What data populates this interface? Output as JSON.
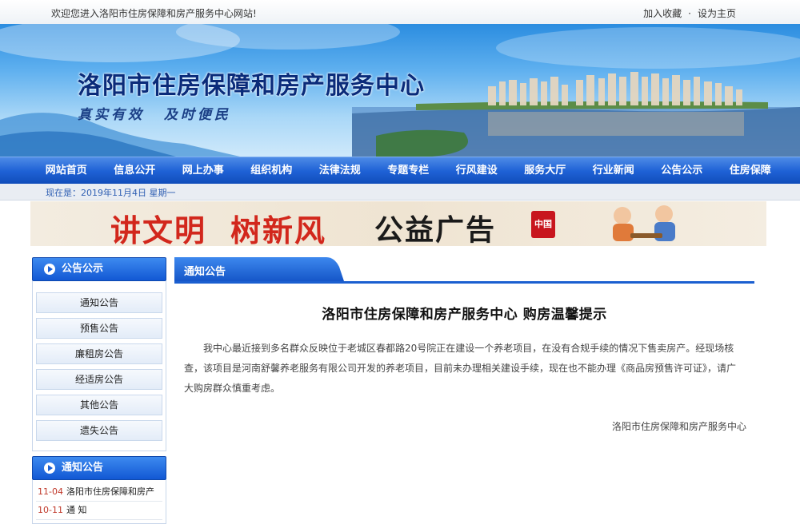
{
  "topbar": {
    "welcome": "欢迎您进入洛阳市住房保障和房产服务中心网站!",
    "favorite": "加入收藏",
    "separator": "·",
    "homepage": "设为主页"
  },
  "banner": {
    "title": "洛阳市住房保障和房产服务中心",
    "slogan": "真实有效 及时便民"
  },
  "nav": {
    "items": [
      "网站首页",
      "信息公开",
      "网上办事",
      "组织机构",
      "法律法规",
      "专题专栏",
      "行风建设",
      "服务大厅",
      "行业新闻",
      "公告公示",
      "住房保障"
    ]
  },
  "date_row": {
    "text": "现在是：2019年11月4日 星期一"
  },
  "ad": {
    "part1": "讲文明",
    "part2": "树新风",
    "part3": "公益广告",
    "seal": "中国梦"
  },
  "sidebar": {
    "section1": {
      "title": "公告公示",
      "items": [
        "通知公告",
        "预售公告",
        "廉租房公告",
        "经适房公告",
        "其他公告",
        "遗失公告"
      ]
    },
    "section2": {
      "title": "通知公告",
      "rows": [
        {
          "date": "11-04",
          "text": "洛阳市住房保障和房产"
        },
        {
          "date": "10-11",
          "text": "通 知"
        }
      ]
    }
  },
  "main": {
    "tab": "通知公告",
    "article_title": "洛阳市住房保障和房产服务中心  购房温馨提示",
    "body": "我中心最近接到多名群众反映位于老城区春都路20号院正在建设一个养老项目，在没有合规手续的情况下售卖房产。经现场核查，该项目是河南舒馨养老服务有限公司开发的养老项目，目前未办理相关建设手续，现在也不能办理《商品房预售许可证》，请广大购房群众慎重考虑。",
    "signature": "洛阳市住房保障和房产服务中心"
  },
  "colors": {
    "nav_blue": "#1f62d6",
    "title_navy": "#0a2b7a",
    "ad_red": "#d2271c",
    "date_red": "#c0392b"
  }
}
